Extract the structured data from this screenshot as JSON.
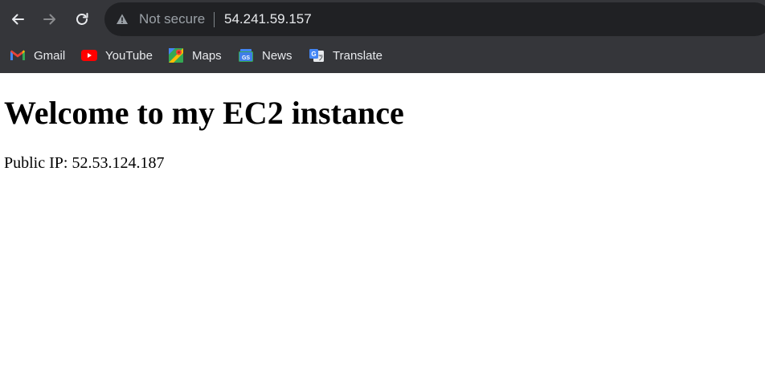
{
  "browser": {
    "security_label": "Not secure",
    "url": "54.241.59.157",
    "icons": {
      "back": "back-arrow-icon",
      "forward": "forward-arrow-icon",
      "reload": "reload-icon",
      "security": "warning-triangle-icon"
    }
  },
  "bookmarks": [
    {
      "label": "Gmail",
      "icon": "gmail-icon"
    },
    {
      "label": "YouTube",
      "icon": "youtube-icon"
    },
    {
      "label": "Maps",
      "icon": "maps-icon"
    },
    {
      "label": "News",
      "icon": "news-icon"
    },
    {
      "label": "Translate",
      "icon": "translate-icon"
    }
  ],
  "page": {
    "heading": "Welcome to my EC2 instance",
    "ip_text": "Public IP: 52.53.124.187"
  },
  "colors": {
    "chrome_bg": "#35363a",
    "omnibox_bg": "#202124",
    "text_light": "#e8eaed",
    "text_muted": "#9aa0a6"
  }
}
